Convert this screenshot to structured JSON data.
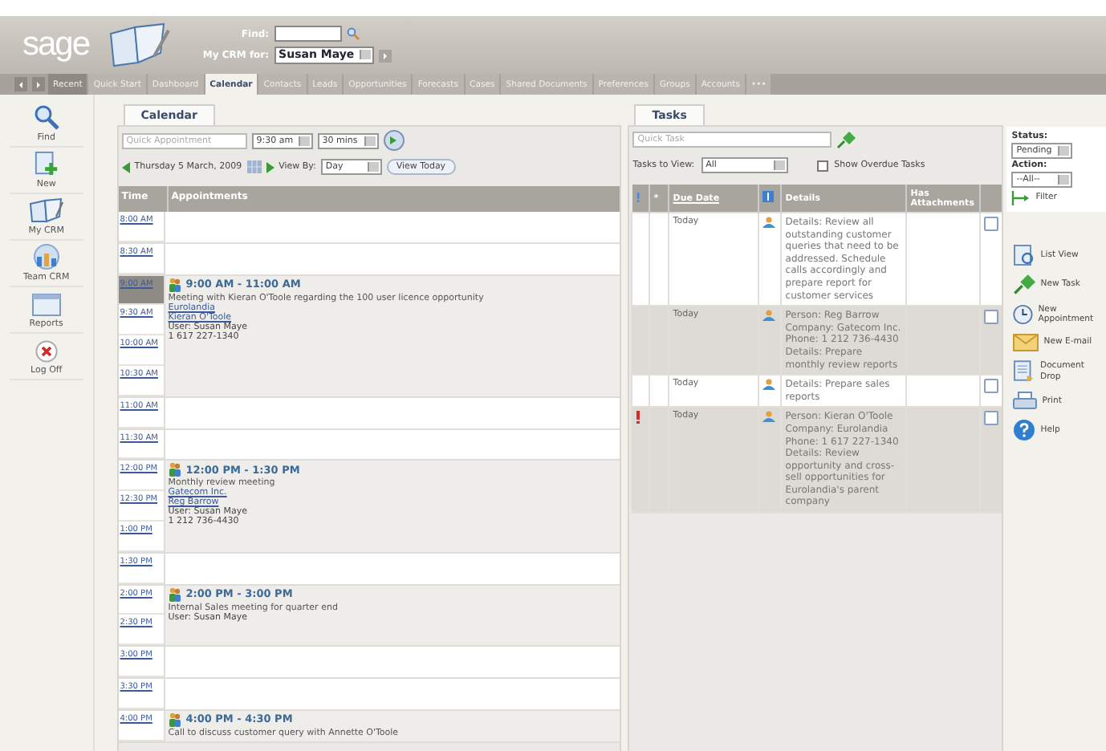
{
  "header": {
    "logo": "sage",
    "find_label": "Find:",
    "crm_label": "My CRM for:",
    "crm_user": "Susan Maye"
  },
  "tabs": [
    {
      "label": "Recent",
      "kind": "history",
      "selected": false
    },
    {
      "label": "Quick Start",
      "kind": "page",
      "selected": false
    },
    {
      "label": "Dashboard",
      "kind": "page",
      "selected": false
    },
    {
      "label": "Calendar",
      "kind": "page",
      "selected": true
    },
    {
      "label": "Contacts",
      "kind": "page",
      "selected": false
    },
    {
      "label": "Leads",
      "kind": "page",
      "selected": false
    },
    {
      "label": "Opportunities",
      "kind": "page",
      "selected": false
    },
    {
      "label": "Forecasts",
      "kind": "page",
      "selected": false
    },
    {
      "label": "Cases",
      "kind": "page",
      "selected": false
    },
    {
      "label": "Shared Documents",
      "kind": "page",
      "selected": false
    },
    {
      "label": "Preferences",
      "kind": "page",
      "selected": false
    },
    {
      "label": "Groups",
      "kind": "page",
      "selected": false
    },
    {
      "label": "Accounts",
      "kind": "page",
      "selected": false
    },
    {
      "label": "•••",
      "kind": "page",
      "selected": false
    }
  ],
  "sidebar": {
    "items": [
      {
        "label": "Find",
        "kind": "find"
      },
      {
        "label": "New",
        "kind": "new"
      },
      {
        "label": "My CRM",
        "kind": "book"
      },
      {
        "label": "Team CRM",
        "kind": "team"
      },
      {
        "label": "Reports",
        "kind": "reports"
      },
      {
        "label": "Log Off",
        "kind": "logoff"
      }
    ]
  },
  "calendar": {
    "tab": "Calendar",
    "quick_placeholder": "Quick Appointment",
    "time": "9:30 am",
    "duration": "30 mins",
    "date": "Thursday 5 March, 2009",
    "view_by_label": "View By:",
    "view_by": "Day",
    "view_today": "View Today",
    "columns": [
      "Time",
      "Appointments"
    ],
    "rows": [
      {
        "kind": "empty",
        "slots": [
          {
            "time": "8:00 AM",
            "selected": false
          }
        ]
      },
      {
        "kind": "empty",
        "slots": [
          {
            "time": "8:30 AM",
            "selected": false
          }
        ]
      },
      {
        "kind": "appointment",
        "slots": [
          {
            "time": "9:00 AM",
            "selected": true
          },
          {
            "time": "9:30 AM",
            "selected": false
          },
          {
            "time": "10:00 AM",
            "selected": false
          },
          {
            "time": "10:30 AM",
            "selected": false
          }
        ],
        "title": "9:00 AM - 11:00 AM",
        "description": "Meeting with Kieran O'Toole regarding the 100 user licence opportunity",
        "links": [
          "Eurolandia",
          "Kieran O'Toole"
        ],
        "user": "User: Susan Maye",
        "phone": "1 617 227-1340"
      },
      {
        "kind": "empty",
        "slots": [
          {
            "time": "11:00 AM",
            "selected": false
          }
        ]
      },
      {
        "kind": "empty",
        "slots": [
          {
            "time": "11:30 AM",
            "selected": false
          }
        ]
      },
      {
        "kind": "appointment",
        "slots": [
          {
            "time": "12:00 PM",
            "selected": false
          },
          {
            "time": "12:30 PM",
            "selected": false
          },
          {
            "time": "1:00 PM",
            "selected": false
          }
        ],
        "title": "12:00 PM - 1:30 PM",
        "description": "Monthly review meeting",
        "links": [
          "Gatecom Inc.",
          "Reg Barrow"
        ],
        "user": "User: Susan Maye",
        "phone": "1 212 736-4430"
      },
      {
        "kind": "empty",
        "slots": [
          {
            "time": "1:30 PM",
            "selected": false
          }
        ]
      },
      {
        "kind": "appointment",
        "slots": [
          {
            "time": "2:00 PM",
            "selected": false
          },
          {
            "time": "2:30 PM",
            "selected": false
          }
        ],
        "title": "2:00 PM - 3:00 PM",
        "description": "Internal Sales meeting for quarter end",
        "user": "User: Susan Maye"
      },
      {
        "kind": "empty",
        "slots": [
          {
            "time": "3:00 PM",
            "selected": false
          }
        ]
      },
      {
        "kind": "empty",
        "slots": [
          {
            "time": "3:30 PM",
            "selected": false
          }
        ]
      },
      {
        "kind": "appointment",
        "slots": [
          {
            "time": "4:00 PM",
            "selected": false
          }
        ],
        "title": "4:00 PM - 4:30 PM",
        "description": "Call to discuss customer query with Annette O'Toole"
      }
    ]
  },
  "tasks": {
    "tab": "Tasks",
    "quick_placeholder": "Quick Task",
    "view_label": "Tasks to View:",
    "view": "All",
    "overdue_label": "Show Overdue Tasks",
    "overdue_checked": false,
    "columns": {
      "priority": "!",
      "star": "*",
      "due": "Due Date",
      "details": "Details",
      "attachments": "Has Attachments"
    },
    "rows": [
      {
        "priority_high": false,
        "due": "Today",
        "details": [
          "Details: Review all outstanding customer queries that need to be addressed. Schedule calls accordingly and prepare report for customer services"
        ],
        "checked": false
      },
      {
        "priority_high": false,
        "due": "Today",
        "details": [
          "Person: Reg Barrow",
          "Company: Gatecom Inc.",
          "Phone: 1 212 736-4430",
          "Details: Prepare monthly review reports"
        ],
        "checked": false
      },
      {
        "priority_high": false,
        "due": "Today",
        "details": [
          "Details: Prepare sales reports"
        ],
        "checked": false
      },
      {
        "priority_high": true,
        "due": "Today",
        "details": [
          "Person: Kieran O'Toole",
          "Company: Eurolandia",
          "Phone: 1 617 227-1340",
          "Details: Review opportunity and cross-sell opportunities for Eurolandia's parent company"
        ],
        "checked": false
      }
    ]
  },
  "filters": {
    "status_label": "Status:",
    "status": "Pending",
    "action_label": "Action:",
    "action": "--All--",
    "filter": "Filter"
  },
  "actions": [
    {
      "label": "List View",
      "kind": "list"
    },
    {
      "label": "New Task",
      "kind": "task"
    },
    {
      "label": "New Appointment",
      "kind": "appointment"
    },
    {
      "label": "New E-mail",
      "kind": "email"
    },
    {
      "label": "Document Drop",
      "kind": "drop"
    },
    {
      "label": "Print",
      "kind": "print"
    },
    {
      "label": "Help",
      "kind": "help"
    }
  ]
}
